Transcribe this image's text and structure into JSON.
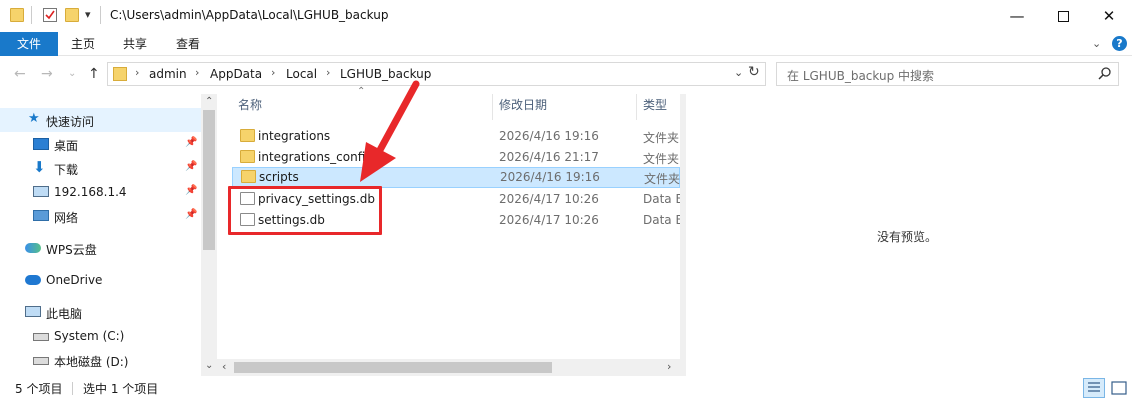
{
  "window": {
    "title": "C:\\Users\\admin\\AppData\\Local\\LGHUB_backup",
    "minimize_icon": "minimize-icon",
    "maximize_icon": "maximize-icon",
    "close_icon": "close-icon"
  },
  "ribbon": {
    "tabs": [
      {
        "label": "文件"
      },
      {
        "label": "主页"
      },
      {
        "label": "共享"
      },
      {
        "label": "查看"
      }
    ]
  },
  "address": {
    "crumbs": [
      "admin",
      "AppData",
      "Local",
      "LGHUB_backup"
    ],
    "search_placeholder": "在 LGHUB_backup 中搜索"
  },
  "nav": {
    "items": [
      {
        "label": "快速访问"
      },
      {
        "label": "桌面"
      },
      {
        "label": "下载"
      },
      {
        "label": "192.168.1.4"
      },
      {
        "label": "网络"
      },
      {
        "label": "WPS云盘"
      },
      {
        "label": "OneDrive"
      },
      {
        "label": "此电脑"
      },
      {
        "label": "System (C:)"
      },
      {
        "label": "本地磁盘 (D:)"
      }
    ]
  },
  "list": {
    "columns": {
      "name": "名称",
      "date": "修改日期",
      "type": "类型"
    },
    "rows": [
      {
        "name": "integrations",
        "date": "2026/4/16 19:16",
        "type": "文件夹",
        "kind": "folder"
      },
      {
        "name": "integrations_config",
        "date": "2026/4/16 21:17",
        "type": "文件夹",
        "kind": "folder"
      },
      {
        "name": "scripts",
        "date": "2026/4/16 19:16",
        "type": "文件夹",
        "kind": "folder",
        "selected": true
      },
      {
        "name": "privacy_settings.db",
        "date": "2026/4/17 10:26",
        "type": "Data Base File",
        "kind": "db"
      },
      {
        "name": "settings.db",
        "date": "2026/4/17 10:26",
        "type": "Data Base File",
        "kind": "db"
      }
    ]
  },
  "preview": {
    "text": "没有预览。"
  },
  "status": {
    "item_count": "5 个项目",
    "selected": "选中 1 个项目"
  },
  "colors": {
    "accent": "#1979ca",
    "selection": "#cce8ff",
    "annotation": "#e8282a"
  }
}
